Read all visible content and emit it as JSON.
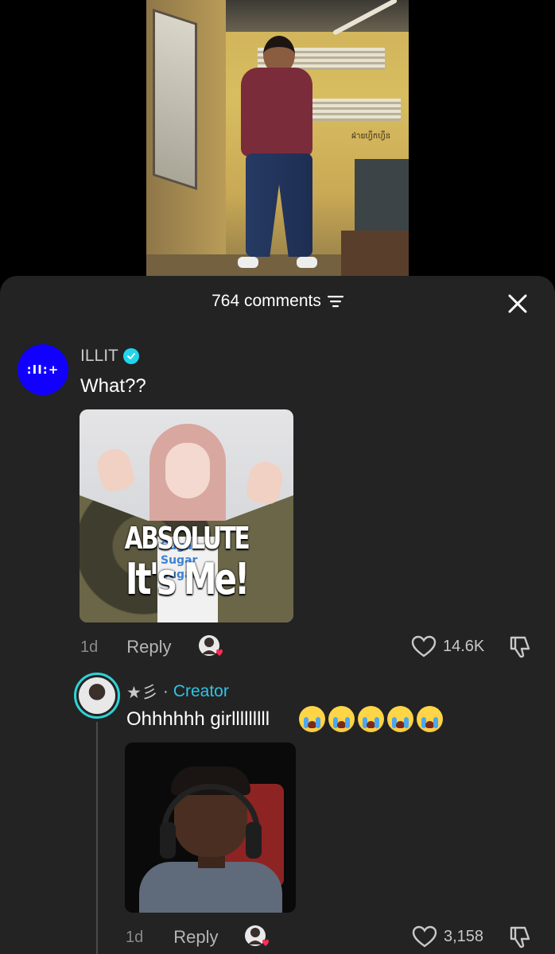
{
  "comments_sheet": {
    "count_label": "764 comments",
    "sort_icon": "sort-lines-icon",
    "close_icon": "close-x-icon"
  },
  "video": {
    "wall_text": "ฝ่ายហ្វឹកហ្វឺន"
  },
  "comments": [
    {
      "username": "ILLIT",
      "verified": true,
      "avatar_text": ":II:+",
      "avatar_color": "#1200ff",
      "text": "What??",
      "image_text_line1": "ABSOLUTE",
      "image_text_line2": "It's Me!",
      "shirt_text": [
        "Sugar",
        "Sugar",
        "Sugar"
      ],
      "time": "1d",
      "reply_label": "Reply",
      "likes": "14.6K"
    },
    {
      "username": "★彡",
      "separator": "·",
      "creator_label": "Creator",
      "text": "Ohhhhhh girlllllllll",
      "emoji_count": 5,
      "time": "1d",
      "reply_label": "Reply",
      "likes": "3,158"
    }
  ],
  "colors": {
    "sheet_background": "#232323",
    "creator_accent": "#2ec4e6",
    "verified_badge": "#20d5ec",
    "like_heart": "#fe2c55"
  }
}
